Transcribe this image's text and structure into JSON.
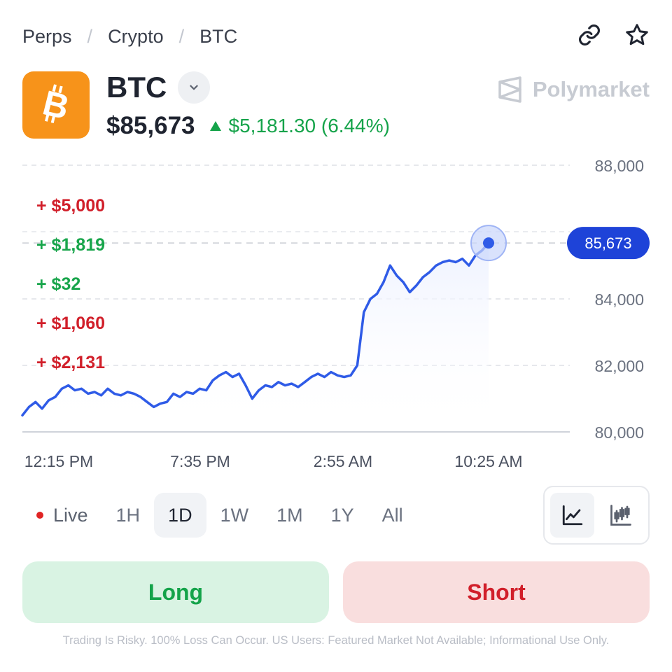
{
  "breadcrumb": [
    "Perps",
    "Crypto",
    "BTC"
  ],
  "asset": {
    "symbol": "BTC",
    "price": "$85,673",
    "change": "$5,181.30 (6.44%)",
    "brand": "Polymarket"
  },
  "pnl_levels": [
    {
      "label": "+ $5,000",
      "kind": "loss"
    },
    {
      "label": "+ $1,819",
      "kind": "gain"
    },
    {
      "label": "+ $32",
      "kind": "gain"
    },
    {
      "label": "+ $1,060",
      "kind": "loss"
    },
    {
      "label": "+ $2,131",
      "kind": "loss"
    }
  ],
  "chart_data": {
    "type": "line",
    "ylim": [
      80000,
      88000
    ],
    "y_ticks": [
      "88,000",
      "84,000",
      "82,000",
      "80,000"
    ],
    "y_tick_values": [
      88000,
      84000,
      82000,
      80000
    ],
    "x_ticks": [
      "12:15 PM",
      "7:35 PM",
      "2:55 AM",
      "10:25 AM"
    ],
    "current_value_label": "85,673",
    "current_value": 85673,
    "series": [
      {
        "color": "#2f5be7",
        "values": [
          80500,
          80750,
          80900,
          80700,
          80950,
          81050,
          81300,
          81400,
          81250,
          81300,
          81150,
          81200,
          81100,
          81300,
          81150,
          81100,
          81200,
          81150,
          81050,
          80900,
          80750,
          80850,
          80900,
          81150,
          81050,
          81200,
          81150,
          81300,
          81250,
          81550,
          81700,
          81800,
          81650,
          81750,
          81400,
          81000,
          81250,
          81400,
          81350,
          81500,
          81400,
          81450,
          81350,
          81500,
          81650,
          81750,
          81650,
          81800,
          81700,
          81650,
          81700,
          82000,
          83600,
          84000,
          84150,
          84500,
          85000,
          84700,
          84500,
          84200,
          84400,
          84650,
          84800,
          85000,
          85100,
          85150,
          85100,
          85200,
          85000,
          85300,
          85450,
          85673
        ]
      }
    ]
  },
  "ranges": [
    "Live",
    "1H",
    "1D",
    "1W",
    "1M",
    "1Y",
    "All"
  ],
  "active_range": "1D",
  "actions": {
    "long": "Long",
    "short": "Short"
  },
  "disclaimer": "Trading Is Risky. 100% Loss Can Occur. US Users: Featured Market Not Available; Informational Use Only.",
  "colors": {
    "gain": "#18a54b",
    "loss": "#d11f2a",
    "line": "#2f5be7",
    "bitcoin": "#f7931a"
  }
}
